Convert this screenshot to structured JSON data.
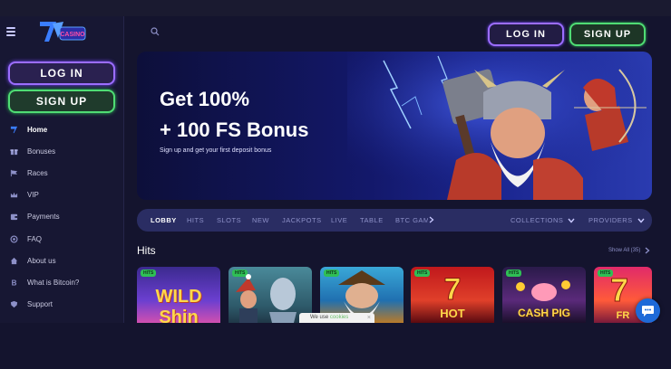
{
  "header": {
    "login_label": "LOG IN",
    "signup_label": "SIGN UP"
  },
  "sidebar": {
    "login_label": "LOG IN",
    "signup_label": "SIGN UP",
    "items": [
      {
        "label": "Home",
        "icon": "logo-icon"
      },
      {
        "label": "Bonuses",
        "icon": "gift-icon"
      },
      {
        "label": "Races",
        "icon": "flag-icon"
      },
      {
        "label": "VIP",
        "icon": "crown-icon"
      },
      {
        "label": "Payments",
        "icon": "wallet-icon"
      },
      {
        "label": "FAQ",
        "icon": "help-icon"
      },
      {
        "label": "About us",
        "icon": "home-icon"
      },
      {
        "label": "What is Bitcoin?",
        "icon": "bitcoin-icon"
      },
      {
        "label": "Support",
        "icon": "shield-icon"
      }
    ]
  },
  "banner": {
    "title_line1": "Get 100%",
    "title_line2": "+ 100 FS Bonus",
    "subtitle": "Sign up and get your first deposit bonus"
  },
  "categories": {
    "items": [
      "LOBBY",
      "HITS",
      "SLOTS",
      "NEW",
      "JACKPOTS",
      "LIVE",
      "TABLE",
      "BTC GAMES"
    ],
    "active": "LOBBY",
    "collections_label": "COLLECTIONS",
    "providers_label": "PROVIDERS"
  },
  "hits": {
    "title": "Hits",
    "show_all": "Show All (35)",
    "badge": "HITS",
    "games": [
      {
        "name": "WILD Shin"
      },
      {
        "name": ""
      },
      {
        "name": ""
      },
      {
        "name": "HOT"
      },
      {
        "name": "CASH PIG"
      },
      {
        "name": "FR"
      }
    ]
  },
  "cookie": {
    "text": "We use",
    "link": "cookies",
    "close": "×"
  },
  "colors": {
    "accent_purple": "#9b6dff",
    "accent_green": "#4fdc74",
    "background": "#14142e",
    "chat_blue": "#1e6ad8"
  }
}
